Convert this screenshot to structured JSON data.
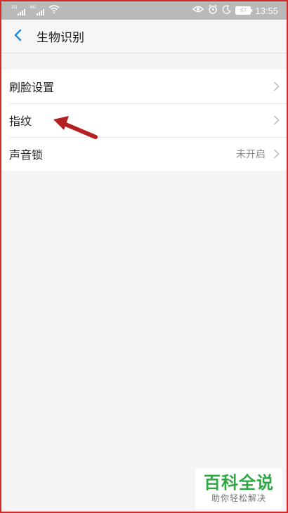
{
  "status_bar": {
    "network_1": "2G",
    "network_2": "4G",
    "battery": "87",
    "time": "13:55",
    "icons": [
      "eye-icon",
      "alarm-icon",
      "moon-icon"
    ]
  },
  "header": {
    "title": "生物识别",
    "back_icon": "chevron-left-icon"
  },
  "settings": {
    "items": [
      {
        "label": "刷脸设置",
        "value": ""
      },
      {
        "label": "指纹",
        "value": ""
      },
      {
        "label": "声音锁",
        "value": "未开启"
      }
    ]
  },
  "annotation": {
    "arrow_color": "#b51f1f"
  },
  "watermark": {
    "title": "百科全说",
    "subtitle": "助你轻松解决"
  },
  "colors": {
    "accent": "#1a8be0",
    "frame_border": "#d22b2b",
    "watermark_green": "#2ea843"
  }
}
